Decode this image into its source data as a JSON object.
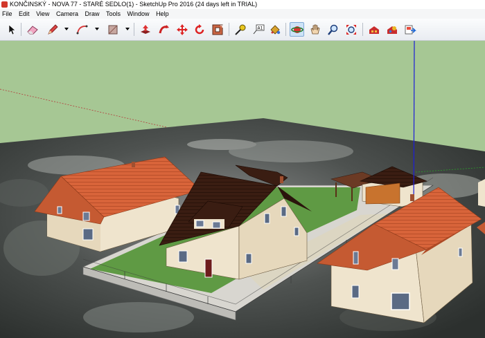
{
  "window": {
    "title": "KONČINSKÝ - NOVA 77 - STARÉ SEDLO(1) - SketchUp Pro 2016 (24 days left in TRIAL)"
  },
  "menu": [
    "File",
    "Edit",
    "View",
    "Camera",
    "Draw",
    "Tools",
    "Window",
    "Help"
  ],
  "toolbar": {
    "tools": [
      "select-icon",
      "eraser-icon",
      "pencil-line-icon",
      "arc-icon",
      "rectangle-icon",
      "push-pull-icon",
      "follow-me-icon",
      "move-icon",
      "rotate-icon",
      "offset-icon",
      "tape-measure-icon",
      "text-icon",
      "paint-bucket-icon",
      "orbit-icon",
      "pan-icon",
      "zoom-icon",
      "zoom-extents-icon",
      "warehouse-icon",
      "extension-warehouse-icon",
      "send-to-layout-icon"
    ],
    "active_tool": "orbit-icon"
  },
  "colors": {
    "sky": "#a6c794",
    "axis_blue": "#1c1cd8",
    "roof_orange": "#d8643a",
    "roof_brown": "#3a1d12",
    "wall": "#efe4cd",
    "grass": "#5f9a44"
  }
}
